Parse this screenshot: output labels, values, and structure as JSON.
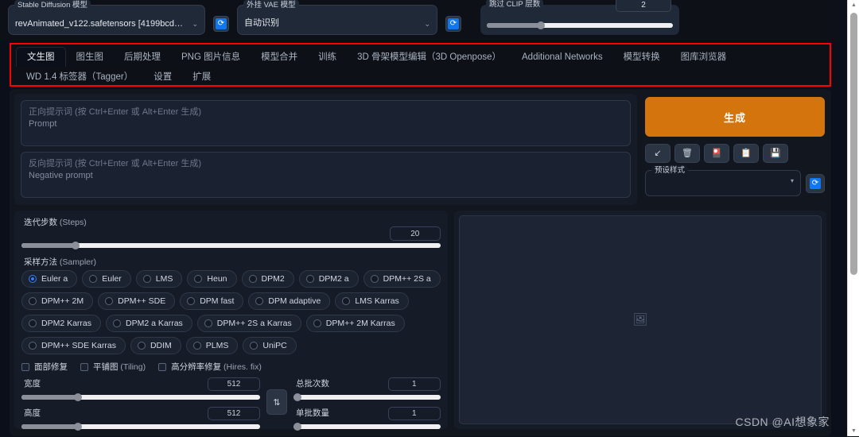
{
  "topbar": {
    "sd_model": {
      "label": "Stable Diffusion 模型",
      "value": "revAnimated_v122.safetensors [4199bcdd14]",
      "caret": "⌄"
    },
    "sd_refresh": {
      "icon": "⟳"
    },
    "vae_model": {
      "label": "外挂 VAE 模型",
      "value": "自动识别",
      "caret": "⌄"
    },
    "vae_refresh": {
      "icon": "⟳"
    },
    "clip_skip": {
      "label": "跳过 CLIP 层数",
      "value": "2"
    }
  },
  "tabs": {
    "row1": [
      {
        "label": "文生图",
        "active": true
      },
      {
        "label": "图生图",
        "active": false
      },
      {
        "label": "后期处理",
        "active": false
      },
      {
        "label": "PNG 图片信息",
        "active": false
      },
      {
        "label": "模型合并",
        "active": false
      },
      {
        "label": "训练",
        "active": false
      },
      {
        "label": "3D 骨架模型编辑（3D Openpose）",
        "active": false
      },
      {
        "label": "Additional Networks",
        "active": false
      },
      {
        "label": "模型转换",
        "active": false
      },
      {
        "label": "图库浏览器",
        "active": false
      }
    ],
    "row2": [
      {
        "label": "WD 1.4 标签器（Tagger）",
        "active": false
      },
      {
        "label": "设置",
        "active": false
      },
      {
        "label": "扩展",
        "active": false
      }
    ]
  },
  "prompt": {
    "positive": {
      "line1": "正向提示词 (按 Ctrl+Enter 或 Alt+Enter 生成)",
      "line2": "Prompt"
    },
    "negative": {
      "line1": "反向提示词 (按 Ctrl+Enter 或 Alt+Enter 生成)",
      "line2": "Negative prompt"
    }
  },
  "generate": {
    "label": "生成",
    "icons": [
      {
        "name": "arrow-down-left-icon",
        "glyph": "↙"
      },
      {
        "name": "trash-icon",
        "glyph": "🗑"
      },
      {
        "name": "cards-icon",
        "glyph": "🎴"
      },
      {
        "name": "clipboard-icon",
        "glyph": "📋"
      },
      {
        "name": "save-icon",
        "glyph": "💾"
      }
    ],
    "preset": {
      "label": "预设样式",
      "value": "",
      "caret": "▾",
      "refresh_icon": "⟳"
    }
  },
  "settings": {
    "steps": {
      "label_cn": "迭代步数",
      "label_en": " (Steps)",
      "value": "20",
      "percent": 13
    },
    "sampler": {
      "label_cn": "采样方法",
      "label_en": " (Sampler)",
      "rows": [
        [
          {
            "label": "Euler a",
            "selected": true
          },
          {
            "label": "Euler",
            "selected": false
          },
          {
            "label": "LMS",
            "selected": false
          },
          {
            "label": "Heun",
            "selected": false
          },
          {
            "label": "DPM2",
            "selected": false
          },
          {
            "label": "DPM2 a",
            "selected": false
          },
          {
            "label": "DPM++ 2S a",
            "selected": false
          }
        ],
        [
          {
            "label": "DPM++ 2M",
            "selected": false
          },
          {
            "label": "DPM++ SDE",
            "selected": false
          },
          {
            "label": "DPM fast",
            "selected": false
          },
          {
            "label": "DPM adaptive",
            "selected": false
          },
          {
            "label": "LMS Karras",
            "selected": false
          }
        ],
        [
          {
            "label": "DPM2 Karras",
            "selected": false
          },
          {
            "label": "DPM2 a Karras",
            "selected": false
          },
          {
            "label": "DPM++ 2S a Karras",
            "selected": false
          },
          {
            "label": "DPM++ 2M Karras",
            "selected": false
          }
        ],
        [
          {
            "label": "DPM++ SDE Karras",
            "selected": false
          },
          {
            "label": "DDIM",
            "selected": false
          },
          {
            "label": "PLMS",
            "selected": false
          },
          {
            "label": "UniPC",
            "selected": false
          }
        ]
      ]
    },
    "checkboxes": [
      {
        "label_cn": "面部修复",
        "label_en": "",
        "checked": false
      },
      {
        "label_cn": "平铺图",
        "label_en": " (Tiling)",
        "checked": false
      },
      {
        "label_cn": "高分辨率修复",
        "label_en": " (Hires. fix)",
        "checked": false
      }
    ],
    "width": {
      "label": "宽度",
      "value": "512",
      "percent": 24
    },
    "height": {
      "label": "高度",
      "value": "512",
      "percent": 24
    },
    "swap": {
      "glyph": "⇅"
    },
    "batch_count": {
      "label": "总批次数",
      "value": "1",
      "percent": 0
    },
    "batch_size": {
      "label": "单批数量",
      "value": "1",
      "percent": 0
    }
  },
  "preview": {
    "placeholder_icon": "🖼"
  },
  "watermark": {
    "text": "CSDN @AI想象家"
  },
  "scrollbar": {
    "up_arrow": "▲",
    "down_arrow": "▼"
  },
  "colors": {
    "accent_orange": "#d4740d",
    "accent_blue": "#2f7ff0",
    "highlight_red": "#ff0000",
    "page_bg": "#0b0f19",
    "panel_bg": "#161c27"
  }
}
